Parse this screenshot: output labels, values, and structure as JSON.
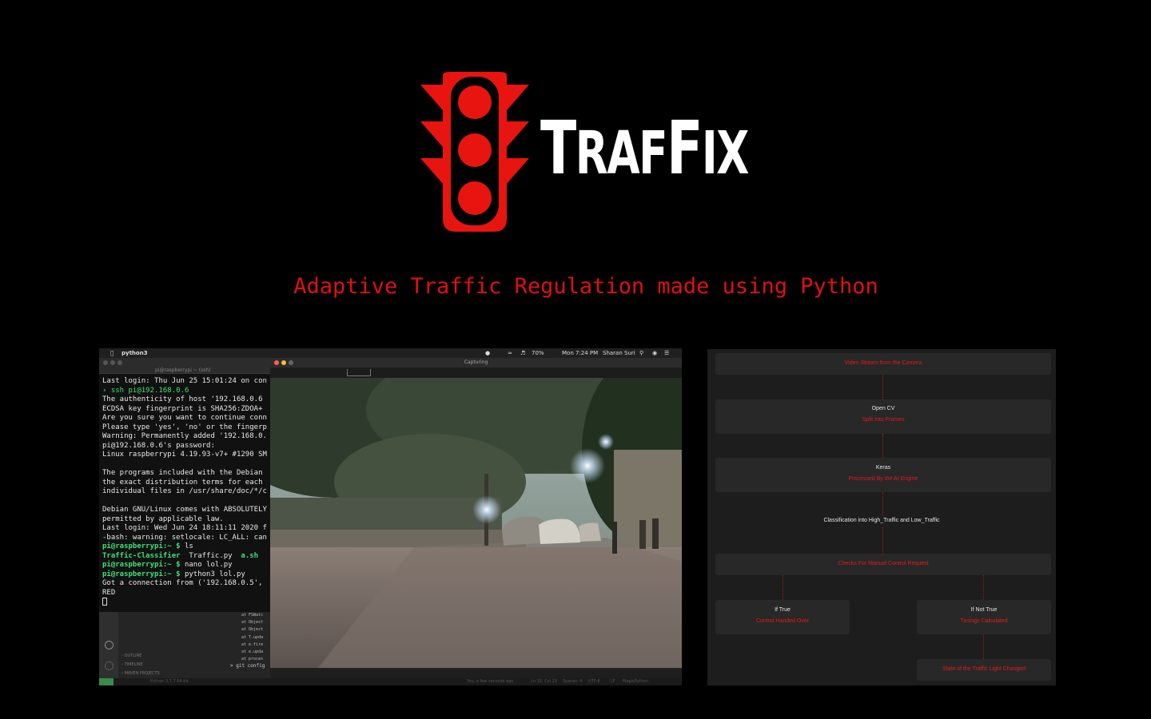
{
  "brand": {
    "name_parts": [
      "T",
      "RAF",
      "F",
      "IX"
    ],
    "tagline": "Adaptive Traffic Regulation made using Python",
    "colors": {
      "accent": "#e8140f",
      "background": "#000000",
      "text": "#ffffff"
    }
  },
  "screenshot": {
    "menubar": {
      "app": "python3",
      "battery": "70%",
      "clock": "Mon 7:24 PM",
      "user": "Sharan Suri"
    },
    "terminal": {
      "title": "pi@raspberrypi ~ (ssh)",
      "lines": [
        "Last login: Thu Jun 25 15:01:24 on con",
        "› ssh pi@192.168.0.6",
        "The authenticity of host '192.168.0.6",
        "ECDSA key fingerprint is SHA256:ZDOA+",
        "Are you sure you want to continue conn",
        "Please type 'yes', 'no' or the fingerp",
        "Warning: Permanently added '192.168.0.",
        "pi@192.168.0.6's password:",
        "Linux raspberrypi 4.19.93-v7+ #1290 SM",
        "",
        "The programs included with the Debian",
        "the exact distribution terms for each",
        "individual files in /usr/share/doc/*/c",
        "",
        "Debian GNU/Linux comes with ABSOLUTELY",
        "permitted by applicable law.",
        "Last login: Wed Jun 24 18:11:11 2020 f",
        "-bash: warning: setlocale: LC_ALL: can"
      ],
      "prompt": "pi@raspberrypi:~ $",
      "cmd_ls": "ls",
      "ls_output": [
        "Traffic-Classifier",
        "Traffic.py",
        "a.sh"
      ],
      "cmd_nano": "nano lol.py",
      "cmd_run": "python3 lol.py",
      "connection_line": "Got a connection from ('192.168.0.5',",
      "result": "RED"
    },
    "ide": {
      "panels": [
        "OUTLINE",
        "TIMELINE",
        "MAVEN PROJECTS"
      ],
      "stack_lines": [
        "at FSWatc",
        "at Object",
        "at Object",
        "at T.upda",
        "at e.fire",
        "at e.upda",
        "at proces"
      ],
      "git_line": "git config",
      "status_python": "Python 3.7.7 64-bit",
      "status_items": [
        "You, a few seconds ago",
        "Ln 12, Col 23",
        "Spaces: 4",
        "UTF-8",
        "LF",
        "MagicPython"
      ]
    },
    "capture_window": {
      "title": "Capturing"
    }
  },
  "flowchart": {
    "stream": "Video Stream from the Camera",
    "opencv": {
      "tool": "Open CV",
      "step": "Split Into Frames"
    },
    "keras": {
      "tool": "Keras",
      "step": "Processed By the AI Engine"
    },
    "classification": "Classification into High_Traffic and Low_Traffic",
    "manual_check": "Checks For Manual Control Request",
    "if_true": {
      "cond": "If True",
      "step": "Control Handed Over"
    },
    "if_not_true": {
      "cond": "If Not True",
      "step": "Timings Calculated"
    },
    "final": "State of the Traffic Light Changed"
  }
}
